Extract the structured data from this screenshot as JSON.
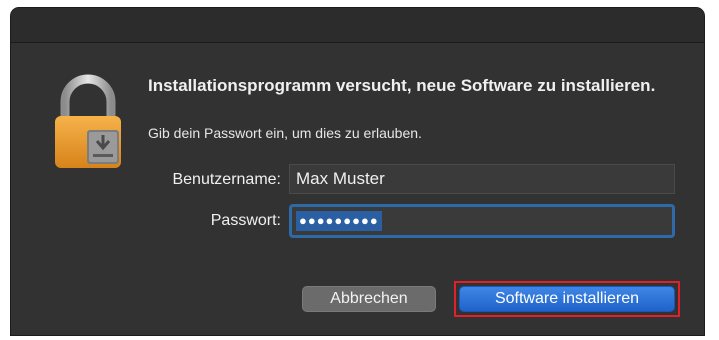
{
  "dialog": {
    "title": "Installationsprogramm versucht, neue Software zu installieren.",
    "subtitle": "Gib dein Passwort ein, um dies zu erlauben.",
    "icon": "lock-installer-icon"
  },
  "form": {
    "username_label": "Benutzername:",
    "username_value": "Max Muster",
    "password_label": "Passwort:",
    "password_value": "●●●●●●●●●"
  },
  "buttons": {
    "cancel_label": "Abbrechen",
    "install_label": "Software installieren"
  },
  "colors": {
    "background": "#323232",
    "accent": "#1f63c9",
    "highlight_outline": "#e0202a"
  }
}
